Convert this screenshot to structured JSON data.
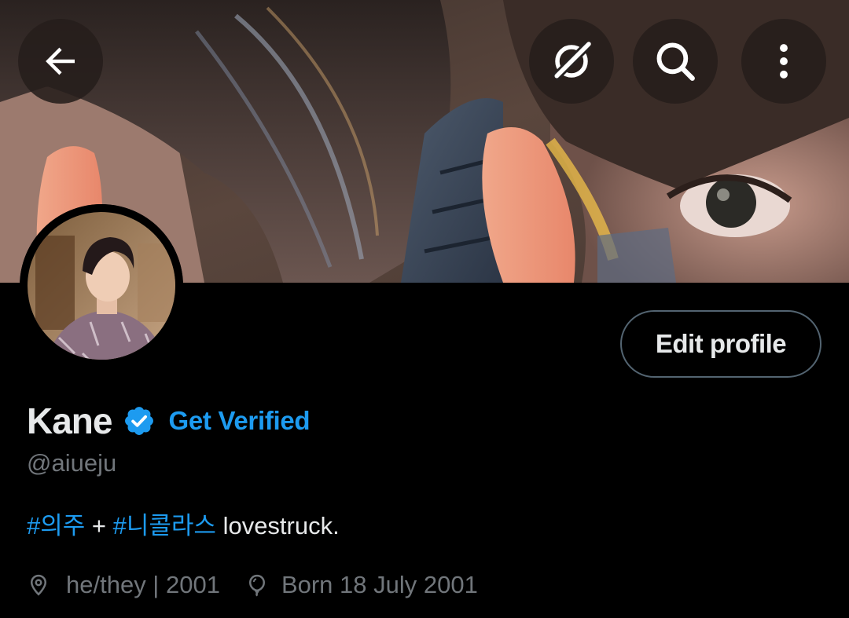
{
  "header": {
    "back_icon": "arrow-left-icon",
    "grok_icon": "grok-icon",
    "search_icon": "search-icon",
    "more_icon": "vertical-dots-icon"
  },
  "profile": {
    "display_name": "Kane",
    "verified_badge_icon": "verified-badge-icon",
    "get_verified_label": "Get Verified",
    "handle": "@aiueju",
    "edit_profile_label": "Edit profile",
    "bio": {
      "hashtag_1": "#의주",
      "separator": " + ",
      "hashtag_2": "#니콜라스",
      "text": " lovestruck."
    },
    "location_icon": "location-pin-icon",
    "location": "he/they | 2001",
    "birthday_icon": "balloon-icon",
    "birthday": "Born 18 July 2001"
  },
  "colors": {
    "background": "#000000",
    "primary_text": "#e7e9ea",
    "secondary_text": "#71767b",
    "accent": "#1d9bf0",
    "button_border": "#536471"
  }
}
